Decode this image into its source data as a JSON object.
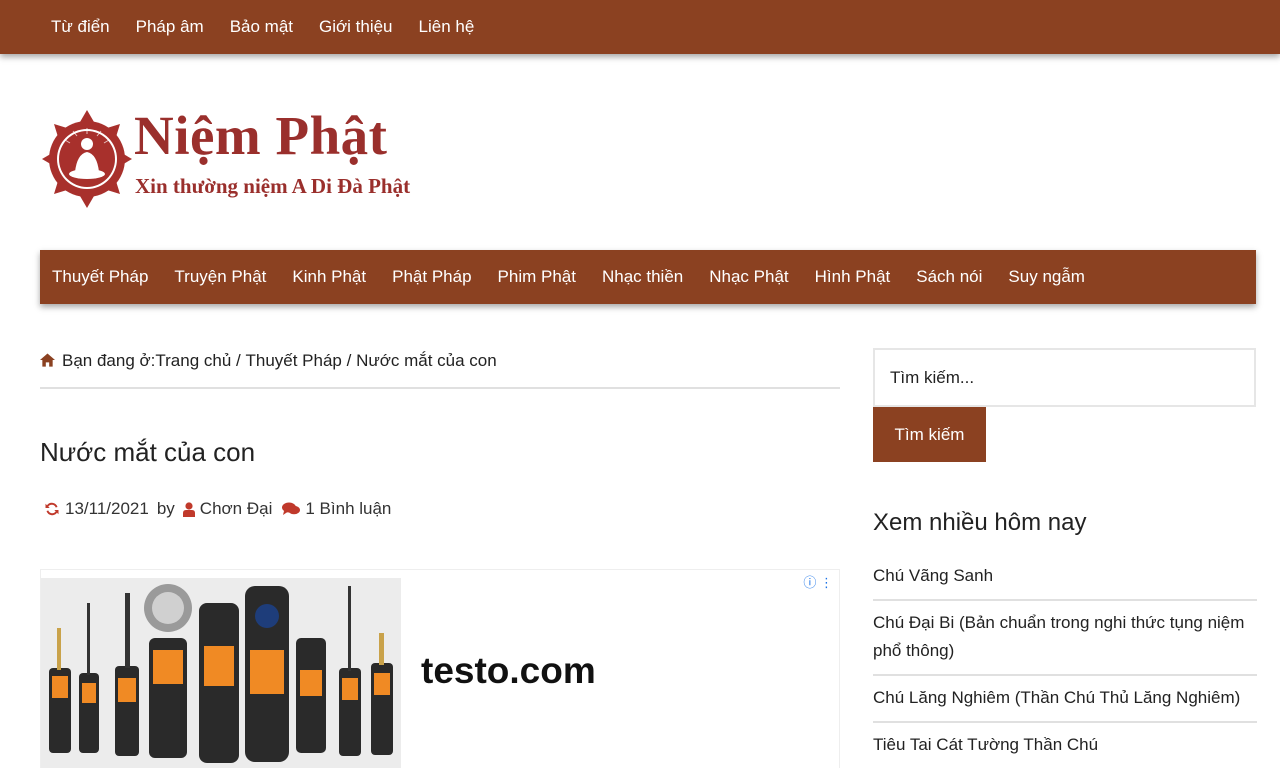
{
  "top_nav": [
    "Từ điển",
    "Pháp âm",
    "Bảo mật",
    "Giới thiệu",
    "Liên hệ"
  ],
  "logo": {
    "title": "Niệm Phật",
    "subtitle": "Xin thường niệm A Di Đà Phật"
  },
  "main_nav": [
    "Thuyết Pháp",
    "Truyện Phật",
    "Kinh Phật",
    "Phật Pháp",
    "Phim Phật",
    "Nhạc thiền",
    "Nhạc Phật",
    "Hình Phật",
    "Sách nói",
    "Suy ngẫm"
  ],
  "breadcrumb": {
    "prefix": "Bạn đang ở:",
    "home": "Trang chủ",
    "sep": " / ",
    "category": "Thuyết Pháp",
    "current": "Nước mắt của con"
  },
  "post": {
    "title": "Nước mắt của con",
    "date": "13/11/2021",
    "by": "by",
    "author": "Chơn Đại",
    "comments": "1 Bình luận"
  },
  "ad": {
    "domain": "testo.com"
  },
  "sidebar": {
    "search_placeholder": "Tìm kiếm...",
    "search_button": "Tìm kiếm",
    "popular_title": "Xem nhiều hôm nay",
    "popular": [
      "Chú Vãng Sanh",
      "Chú Đại Bi (Bản chuẩn trong nghi thức tụng niệm phổ thông)",
      "Chú Lăng Nghiêm (Thần Chú Thủ Lăng Nghiêm)",
      "Tiêu Tai Cát Tường Thần Chú"
    ]
  },
  "colors": {
    "nav_bg": "#8b4121",
    "brand_red": "#9a2f2c",
    "icon_red": "#c0392b"
  }
}
